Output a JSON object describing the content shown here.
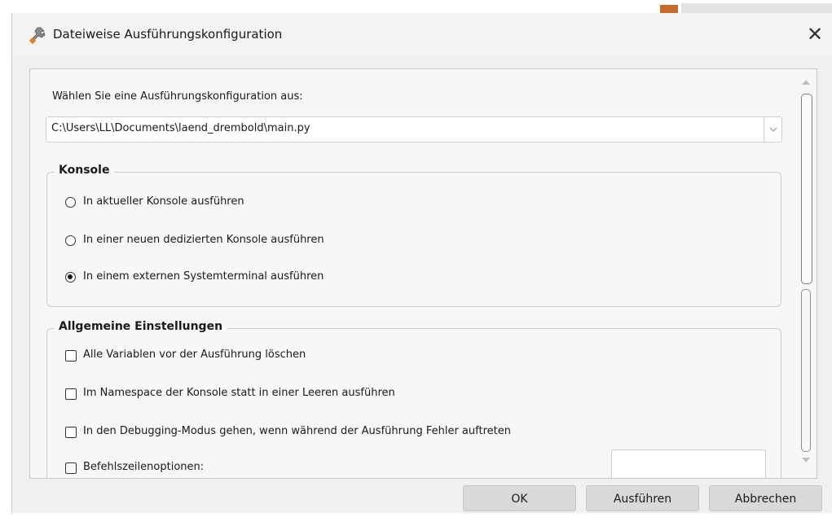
{
  "dialog": {
    "title": "Dateiweise Ausführungskonfiguration",
    "close_glyph": "✕"
  },
  "config": {
    "choose_label": "Wählen Sie eine Ausführungskonfiguration aus:",
    "selected_file": "C:\\Users\\LL\\Documents\\laend_drembold\\main.py"
  },
  "console_group": {
    "title": "Konsole",
    "options": [
      {
        "label": "In aktueller Konsole ausführen",
        "selected": false
      },
      {
        "label": "In einer neuen dedizierten Konsole ausführen",
        "selected": false
      },
      {
        "label": "In einem externen Systemterminal ausführen",
        "selected": true
      }
    ]
  },
  "general_group": {
    "title": "Allgemeine Einstellungen",
    "options": [
      {
        "label": "Alle Variablen vor der Ausführung löschen",
        "checked": false
      },
      {
        "label": "Im Namespace der Konsole statt in einer Leeren ausführen",
        "checked": false
      },
      {
        "label": "In den Debugging-Modus gehen, wenn während der Ausführung Fehler auftreten",
        "checked": false
      },
      {
        "label": "Befehlszeilenoptionen:",
        "checked": false
      }
    ],
    "command_line_value": ""
  },
  "buttons": {
    "ok": "OK",
    "run": "Ausführen",
    "cancel": "Abbrechen"
  },
  "icons": {
    "title": "wrench-icon",
    "combo": "chevron-down-icon",
    "scroll_up": "scroll-up-arrow-icon",
    "scroll_down": "scroll-down-arrow-icon"
  },
  "colors": {
    "dialog_bg": "#f0f0f0",
    "button_bg": "#d9d9d9"
  }
}
